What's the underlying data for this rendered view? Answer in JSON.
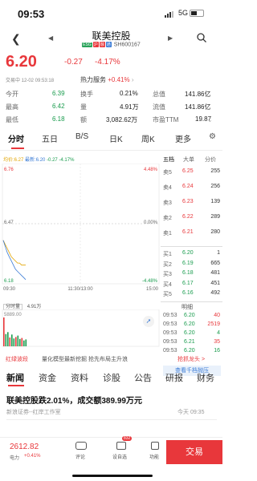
{
  "status_bar": {
    "time": "09:53",
    "network": "5G"
  },
  "header": {
    "stock_name": "联美控股",
    "tags": [
      "ESG",
      "沪",
      "融",
      "通"
    ],
    "code": "SH600167"
  },
  "quote": {
    "price": "6.20",
    "change": "-0.27",
    "change_pct": "-4.17%",
    "trade_time": "交易中 12-02 09:53:18",
    "hot_service_label": "热力服务",
    "hot_service_pct": "+0.41%"
  },
  "stats": [
    {
      "label": "今开",
      "value": "6.39",
      "label2": "换手",
      "value2": "0.21%",
      "label3": "总值",
      "value3": "141.86亿"
    },
    {
      "label": "最高",
      "value": "6.42",
      "label2": "量",
      "value2": "4.91万",
      "label3": "流值",
      "value3": "141.86亿"
    },
    {
      "label": "最低",
      "value": "6.18",
      "label2": "额",
      "value2": "3,082.62万",
      "label3": "市盈TTM",
      "value3": "19.87"
    }
  ],
  "tabs": [
    "分时",
    "五日",
    "B/S",
    "日K",
    "周K",
    "更多"
  ],
  "chart_data": {
    "type": "line",
    "info_line": {
      "avg": "均价:6.27",
      "latest": "最新:6.20",
      "change": "-0.27",
      "pct": "-4.17%"
    },
    "y_labels_left": [
      "6.76",
      "6.47",
      "6.18"
    ],
    "y_labels_right": [
      "4.48%",
      "0.00%",
      "-4.48%"
    ],
    "x_labels": [
      "09:30",
      "11:30/13:00",
      "15:00"
    ],
    "price_series": [
      6.39,
      6.36,
      6.33,
      6.31,
      6.29,
      6.27,
      6.25,
      6.24,
      6.23,
      6.22,
      6.21,
      6.2
    ],
    "avg_series": [
      6.39,
      6.37,
      6.35,
      6.33,
      6.31,
      6.3,
      6.29,
      6.28,
      6.28,
      6.27,
      6.27,
      6.27
    ],
    "ylim": [
      6.18,
      6.76
    ],
    "volume_label": "分时量",
    "volume_value": "4.91万",
    "volume_axis": "5889.00",
    "volumes": [
      5889,
      2500,
      2900,
      1800,
      2400,
      1600,
      1900,
      2200,
      1500,
      1700,
      1200,
      1400
    ]
  },
  "order_book": {
    "tab1": "五档",
    "tab2": "大单",
    "tab3": "分价",
    "asks": [
      {
        "label": "卖5",
        "price": "6.25",
        "vol": "255"
      },
      {
        "label": "卖4",
        "price": "6.24",
        "vol": "256"
      },
      {
        "label": "卖3",
        "price": "6.23",
        "vol": "139"
      },
      {
        "label": "卖2",
        "price": "6.22",
        "vol": "289"
      },
      {
        "label": "卖1",
        "price": "6.21",
        "vol": "280"
      }
    ],
    "bids": [
      {
        "label": "买1",
        "price": "6.20",
        "vol": "1"
      },
      {
        "label": "买2",
        "price": "6.19",
        "vol": "665"
      },
      {
        "label": "买3",
        "price": "6.18",
        "vol": "481"
      },
      {
        "label": "买4",
        "price": "6.17",
        "vol": "451"
      },
      {
        "label": "买5",
        "price": "6.16",
        "vol": "492"
      }
    ],
    "detail_label": "明细",
    "ticks": [
      {
        "time": "09:53",
        "price": "6.20",
        "vol": "40",
        "color": "red"
      },
      {
        "time": "09:53",
        "price": "6.20",
        "vol": "2519",
        "color": "red"
      },
      {
        "time": "09:53",
        "price": "6.20",
        "vol": "4",
        "color": "green"
      },
      {
        "time": "09:53",
        "price": "6.21",
        "vol": "35",
        "color": "red"
      },
      {
        "time": "09:53",
        "price": "6.20",
        "vol": "16",
        "color": "green"
      }
    ],
    "view_more": "查看千档抛压"
  },
  "strip": {
    "left": "红绿波段",
    "middle": "量化模型最新挖掘 抢先布局主升浪",
    "right": "抢抓龙头 >"
  },
  "news_tabs": [
    "新闻",
    "资金",
    "资料",
    "诊股",
    "公告",
    "研报",
    "财务"
  ],
  "news": {
    "headline": "联美控股跌2.01%，成交额389.99万元",
    "source": "新浪证券--红岸工作室",
    "time": "今天 09:35"
  },
  "bottom": {
    "index_value": "2612.82",
    "index_label": "电力",
    "index_pct": "+0.41%",
    "comment": "评论",
    "badge": "832",
    "discuss": "设自选",
    "function": "功能",
    "trade": "交易"
  },
  "colors": {
    "up": "#e8373b",
    "down": "#1a9c4e",
    "avg": "#e2a400",
    "line": "#3a7bd5"
  }
}
